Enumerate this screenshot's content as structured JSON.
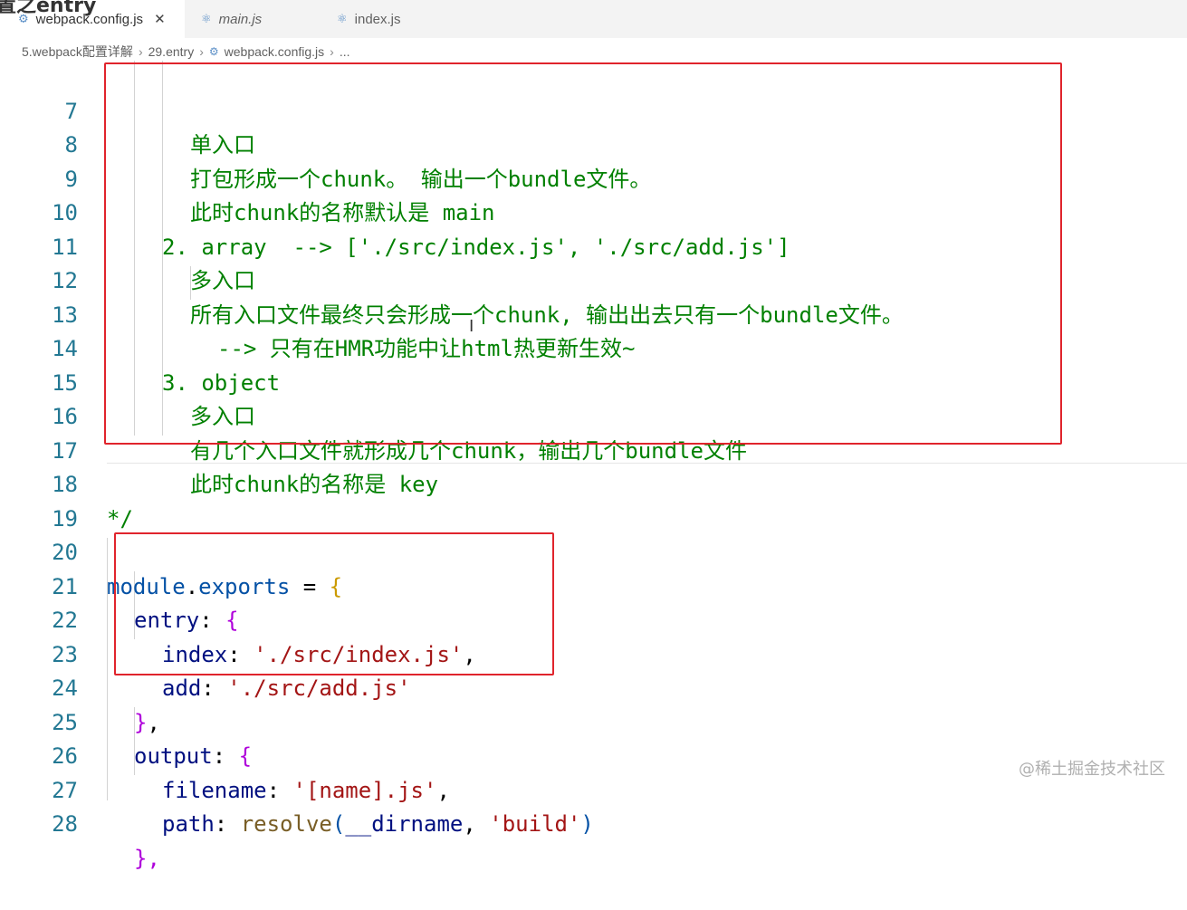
{
  "overlay": {
    "title": "置之entry"
  },
  "tabs": [
    {
      "label": "webpack.config.js",
      "close": "✕",
      "active": true
    },
    {
      "label": "main.js",
      "italic": true
    },
    {
      "label": "index.js"
    }
  ],
  "breadcrumb": [
    "5.webpack配置详解",
    "29.entry",
    "webpack.config.js",
    "..."
  ],
  "lines": {
    "l7": "7",
    "l8": "8",
    "l9": "9",
    "l10": "10",
    "l11": "11",
    "l12": "12",
    "l13": "13",
    "l14": "14",
    "l15": "15",
    "l16": "16",
    "l17": "17",
    "l18": "18",
    "l19": "19",
    "l20": "20",
    "l21": "21",
    "l22": "22",
    "l23": "23",
    "l24": "24",
    "l25": "25",
    "l26": "26",
    "l27": "27",
    "l28": "28"
  },
  "code": {
    "c7": "单入口",
    "c8": "打包形成一个chunk。 输出一个bundle文件。",
    "c9": "此时chunk的名称默认是 main",
    "c10": "2. array  --> ['./src/index.js', './src/add.js']",
    "c11": "多入口",
    "c12": "所有入口文件最终只会形成一个chunk, 输出出去只有一个bundle文件。",
    "c13": "--> 只有在HMR功能中让html热更新生效~",
    "c14": "3. object",
    "c15": "多入口",
    "c16": "有几个入口文件就形成几个chunk，输出几个bundle文件",
    "c17": "此时chunk的名称是 key",
    "c18": "*/",
    "c20_module": "module",
    "c20_dot": ".",
    "c20_exports": "exports",
    "c20_eq": " = ",
    "c20_brace": "{",
    "c21_key": "entry",
    "c21_colon": ": ",
    "c21_brace": "{",
    "c22_key": "index",
    "c22_colon": ": ",
    "c22_val": "'./src/index.js'",
    "c22_comma": ",",
    "c23_key": "add",
    "c23_colon": ": ",
    "c23_val": "'./src/add.js'",
    "c24_brace": "}",
    "c24_comma": ",",
    "c25_key": "output",
    "c25_colon": ": ",
    "c25_brace": "{",
    "c26_key": "filename",
    "c26_colon": ": ",
    "c26_val": "'[name].js'",
    "c26_comma": ",",
    "c27_key": "path",
    "c27_colon": ": ",
    "c27_fn": "resolve",
    "c27_paren_open": "(",
    "c27_arg1": "__dirname",
    "c27_sep": ", ",
    "c27_arg2": "'build'",
    "c27_paren_close": ")",
    "c28": "},"
  },
  "watermark": "@稀土掘金技术社区",
  "colors": {
    "comment": "#008000",
    "string": "#a31515",
    "property": "#001080",
    "keyword": "#0000ff",
    "highlight_box": "#e0242c",
    "line_number": "#237893"
  }
}
